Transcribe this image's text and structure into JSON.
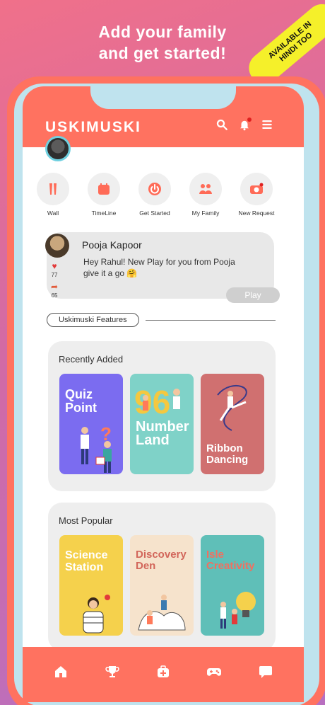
{
  "headline": {
    "line1": "Add your family",
    "line2": "and get started!"
  },
  "ribbon": {
    "line1": "AVAILABLE IN",
    "line2": "HINDI TOO"
  },
  "app": {
    "brand": "USKIMUSKI"
  },
  "quick_actions": [
    {
      "label": "Wall",
      "icon": "wall-icon"
    },
    {
      "label": "TimeLine",
      "icon": "calendar-icon"
    },
    {
      "label": "Get Started",
      "icon": "power-icon"
    },
    {
      "label": "My Family",
      "icon": "family-icon"
    },
    {
      "label": "New Request",
      "icon": "camera-icon"
    }
  ],
  "post": {
    "name": "Pooja Kapoor",
    "message": "Hey Rahul! New Play for you from Pooja give it a go 🤗",
    "likes": "77",
    "shares": "65",
    "play_label": "Play"
  },
  "features_label": "Uskimuski Features",
  "recently_added": {
    "title": "Recently Added",
    "cards": [
      {
        "title": "Quiz Point",
        "color": "#7b6cf0"
      },
      {
        "title": "Number Land",
        "color": "#7fd2c8"
      },
      {
        "title": "Ribbon Dancing",
        "color": "#d07070"
      }
    ]
  },
  "most_popular": {
    "title": "Most Popular",
    "cards": [
      {
        "title": "Science Station",
        "color": "#f5d14c"
      },
      {
        "title": "Discovery Den",
        "color": "#f6e3cc"
      },
      {
        "title": "Isle Creativity",
        "color": "#5fbfb8"
      }
    ]
  },
  "bottom_nav": [
    "home-icon",
    "trophy-icon",
    "medical-icon",
    "gamepad-icon",
    "chat-icon"
  ]
}
